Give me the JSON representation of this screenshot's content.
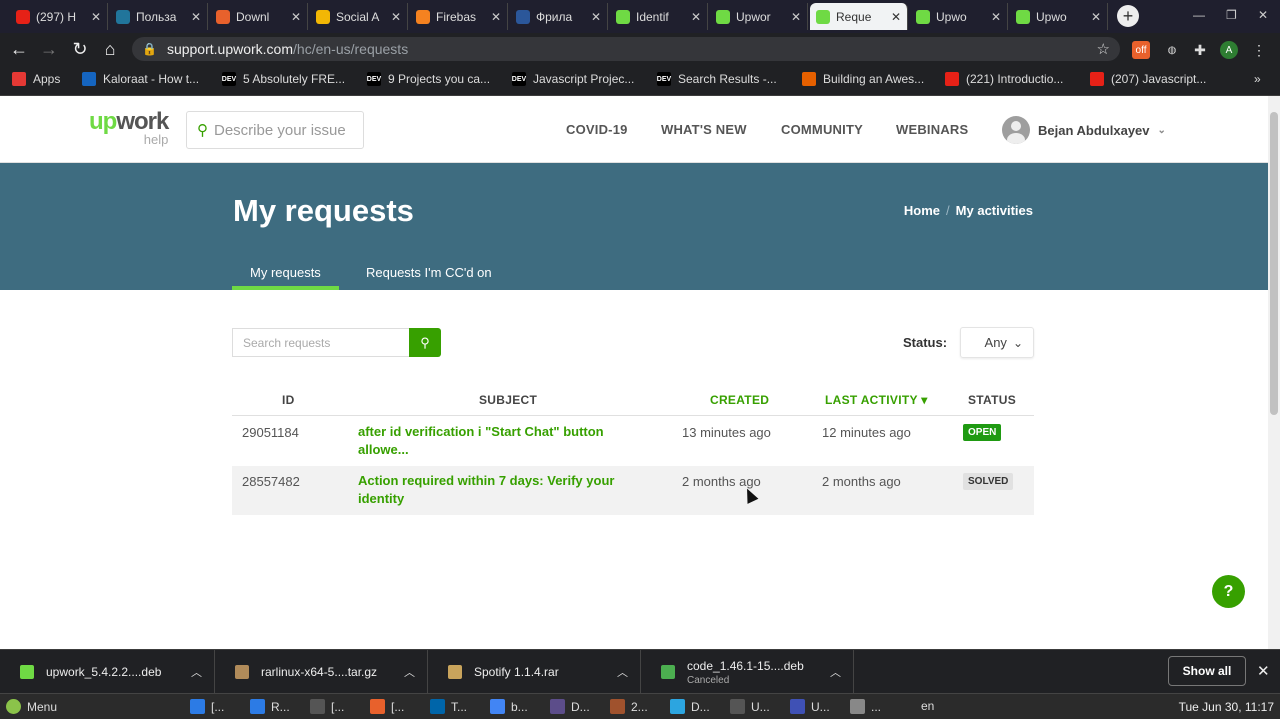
{
  "browser": {
    "tabs": [
      {
        "title": "(297) Н",
        "icon": "youtube-icon",
        "color": "#e62117"
      },
      {
        "title": "Польза",
        "icon": "wordpress-icon",
        "color": "#21759b"
      },
      {
        "title": "Downl",
        "icon": "download-site-icon",
        "color": "#e8612c"
      },
      {
        "title": "Social A",
        "icon": "social-icon",
        "color": "#f2b705"
      },
      {
        "title": "Firebas",
        "icon": "firebase-icon",
        "color": "#f58220"
      },
      {
        "title": "Фрила",
        "icon": "word-icon",
        "color": "#2b579a"
      },
      {
        "title": "Identif",
        "icon": "upwork-icon",
        "color": "#6fda44"
      },
      {
        "title": "Upwor",
        "icon": "upwork-icon",
        "color": "#6fda44"
      },
      {
        "title": "Reque",
        "icon": "upwork-icon",
        "color": "#6fda44",
        "active": true
      },
      {
        "title": "Upwo",
        "icon": "upwork-icon",
        "color": "#6fda44"
      },
      {
        "title": "Upwo",
        "icon": "upwork-icon",
        "color": "#6fda44"
      }
    ],
    "url_host": "support.upwork.com",
    "url_path": "/hc/en-us/requests",
    "profile_initial": "A",
    "bookmarks": [
      {
        "label": "Apps",
        "icon": "apps-icon"
      },
      {
        "label": "Kaloraat - How t...",
        "icon": "k-icon"
      },
      {
        "label": "5 Absolutely FRE...",
        "icon": "dev-icon"
      },
      {
        "label": "9 Projects you ca...",
        "icon": "dev-icon"
      },
      {
        "label": "Javascript Projec...",
        "icon": "dev-icon"
      },
      {
        "label": "Search Results -...",
        "icon": "dev-icon"
      },
      {
        "label": "Building an Awes...",
        "icon": "firefox-icon"
      },
      {
        "label": "(221) Introductio...",
        "icon": "youtube-icon"
      },
      {
        "label": "(207) Javascript...",
        "icon": "youtube-icon"
      }
    ],
    "bookmarks_overflow": "»"
  },
  "site": {
    "logo_up": "up",
    "logo_work": "work",
    "logo_help": "help",
    "search_placeholder": "Describe your issue",
    "nav": [
      "COVID-19",
      "WHAT'S NEW",
      "COMMUNITY",
      "WEBINARS"
    ],
    "user_name": "Bejan Abdulxayev",
    "accent": "#37a000",
    "hero_color": "#3e6c80"
  },
  "hero": {
    "title": "My requests",
    "breadcrumb": [
      "Home",
      "My activities"
    ],
    "tabs": [
      "My requests",
      "Requests I'm CC'd on"
    ]
  },
  "filters": {
    "search_placeholder": "Search requests",
    "status_label": "Status:",
    "status_value": "Any"
  },
  "table": {
    "headers": [
      "ID",
      "SUBJECT",
      "CREATED",
      "LAST ACTIVITY ▾",
      "STATUS"
    ],
    "rows": [
      {
        "id": "29051184",
        "subject": "after id verification i \"Start Chat\" button allowe...",
        "created": "13 minutes ago",
        "last_activity": "12 minutes ago",
        "status": "OPEN"
      },
      {
        "id": "28557482",
        "subject": "Action required within 7 days: Verify your identity",
        "created": "2 months ago",
        "last_activity": "2 months ago",
        "status": "SOLVED"
      }
    ]
  },
  "downloads": {
    "items": [
      {
        "name": "upwork_5.4.2.2....deb",
        "sub": ""
      },
      {
        "name": "rarlinux-x64-5....tar.gz",
        "sub": ""
      },
      {
        "name": "Spotify 1.1.4.rar",
        "sub": ""
      },
      {
        "name": "code_1.46.1-15....deb",
        "sub": "Canceled"
      }
    ],
    "show_all": "Show all"
  },
  "taskbar": {
    "menu": "Menu",
    "items": [
      "[...",
      "R...",
      "[...",
      "[...",
      "T...",
      "b...",
      "D...",
      "2...",
      "D...",
      "U...",
      "U...",
      "..."
    ],
    "lang": "en",
    "clock": "Tue Jun 30, 11:17"
  }
}
